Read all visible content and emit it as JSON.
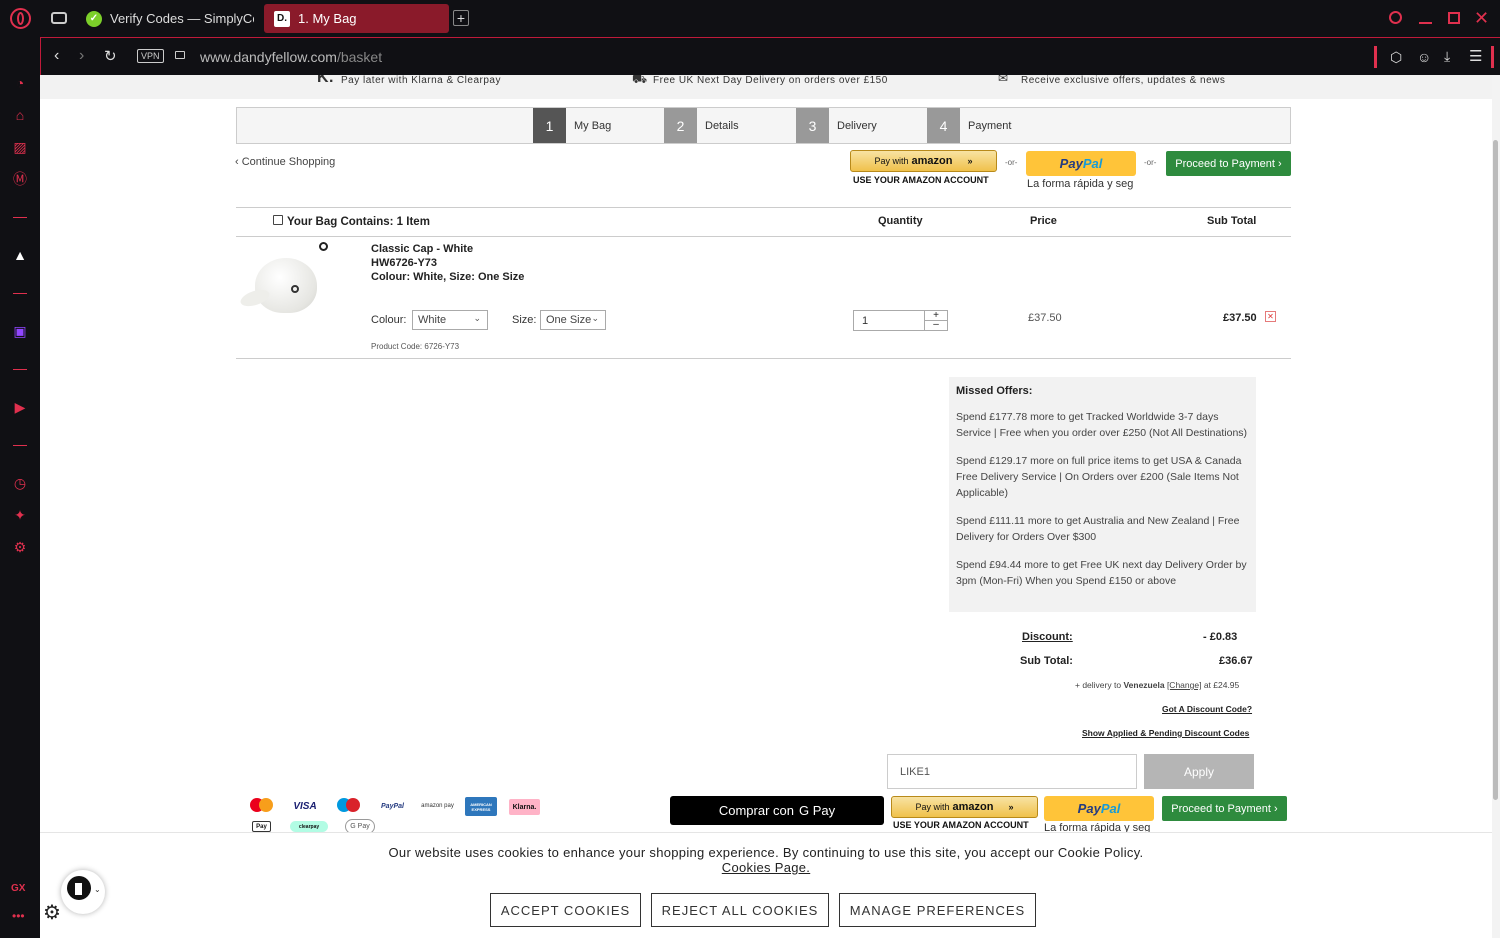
{
  "browser": {
    "tabs": [
      {
        "label": "Verify Codes — SimplyCo",
        "favicon": "S"
      },
      {
        "label": "1. My Bag",
        "favicon": "D."
      }
    ],
    "url_host": "www.dandyfellow.com",
    "url_path": "/basket",
    "vpn_label": "VPN",
    "sidebar_gx": "GX"
  },
  "promo": {
    "klarna": "Pay later with Klarna & Clearpay",
    "klarna_logo": "K.",
    "delivery": "Free UK Next Day Delivery on orders over £150",
    "offers": "Receive exclusive offers, updates & news"
  },
  "steps": [
    {
      "num": "1",
      "label": "My Bag"
    },
    {
      "num": "2",
      "label": "Details"
    },
    {
      "num": "3",
      "label": "Delivery"
    },
    {
      "num": "4",
      "label": "Payment"
    }
  ],
  "checkout": {
    "continue": "‹ Continue Shopping",
    "amazon_pay_prefix": "Pay with",
    "amazon_word": "amazon",
    "amazon_sub": "USE YOUR AMAZON ACCOUNT",
    "or": "-or-",
    "paypal_pay": "Pay",
    "paypal_pal": "Pal",
    "paypal_sub": "La forma rápida y seg",
    "proceed": "Proceed to Payment ›",
    "gpay": "Comprar con",
    "gpay_brand": "G Pay"
  },
  "table": {
    "bag_contains": "Your Bag Contains: 1 Item",
    "quantity": "Quantity",
    "price": "Price",
    "subtotal": "Sub Total"
  },
  "item": {
    "name": "Classic Cap - White",
    "sku": "HW6726-Y73",
    "details": "Colour: White, Size: One Size",
    "colour_label": "Colour:",
    "colour_value": "White",
    "size_label": "Size:",
    "size_value": "One Size",
    "product_code": "Product Code: 6726-Y73",
    "qty": "1",
    "price": "£37.50",
    "subtotal": "£37.50"
  },
  "missed": {
    "title": "Missed Offers:",
    "offers": [
      "Spend £177.78 more to get Tracked Worldwide 3-7 days Service | Free when you order over £250 (Not All Destinations)",
      "Spend £129.17 more on full price items to get USA & Canada Free Delivery Service | On Orders over £200 (Sale Items Not Applicable)",
      "Spend £111.11 more to get Australia and New Zealand | Free Delivery for Orders Over $300",
      "Spend £94.44 more to get Free UK next day Delivery Order by 3pm (Mon-Fri) When you Spend £150 or above"
    ]
  },
  "totals": {
    "discount_label": "Discount:",
    "discount_value": "- £0.83",
    "subtotal_label": "Sub Total:",
    "subtotal_value": "£36.67",
    "delivery_prefix": "+ delivery to",
    "delivery_country": "Venezuela",
    "delivery_change": "[Change]",
    "delivery_suffix": "at £24.95",
    "got_code": "Got A Discount Code?",
    "show_codes": "Show Applied & Pending Discount Codes",
    "discount_code_value": "LIKE1",
    "apply": "Apply"
  },
  "payment_icons": [
    "mastercard",
    "VISA",
    "maestro",
    "PayPal",
    "amazon pay",
    "AMERICAN EXPRESS",
    "Klarna.",
    "Pay",
    "clearpay",
    "G Pay"
  ],
  "cookie": {
    "message": "Our website uses cookies to enhance your shopping experience. By continuing to use this site, you accept our Cookie Policy.",
    "policy_link": "Cookies Page.",
    "accept": "ACCEPT COOKIES",
    "reject": "REJECT ALL COOKIES",
    "manage": "MANAGE PREFERENCES"
  },
  "colors": {
    "accent_red": "#e0304e",
    "tab_active": "#8a1a2a",
    "step_active": "#555555",
    "step_inactive": "#999999",
    "green": "#2e8b3e"
  }
}
